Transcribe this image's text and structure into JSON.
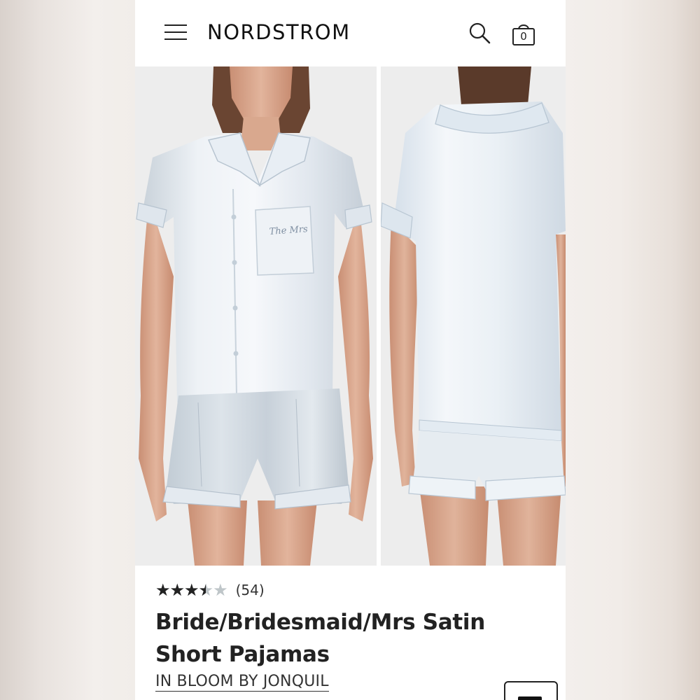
{
  "header": {
    "brand_logo": "NORDSTROM",
    "cart_count": "0",
    "icons": [
      "menu-icon",
      "search-icon",
      "shopping-bag-icon"
    ]
  },
  "gallery": {
    "images": [
      {
        "view": "front",
        "pocket_embroidery": "The Mrs"
      },
      {
        "view": "back"
      }
    ]
  },
  "product": {
    "rating": 3.5,
    "rating_max": 5,
    "stars_glyph": "★★★★★",
    "review_count": "(54)",
    "title": "Bride/Bridesmaid/Mrs Satin Short Pajamas",
    "brand": "IN BLOOM BY JONQUIL"
  },
  "colors": {
    "satin": "#e3e9ef",
    "satin_shadow": "#b8c3cd",
    "skin": "#d9ab93",
    "hair": "#5a3a2a",
    "text": "#222222",
    "star_empty": "#bfc6c9"
  }
}
